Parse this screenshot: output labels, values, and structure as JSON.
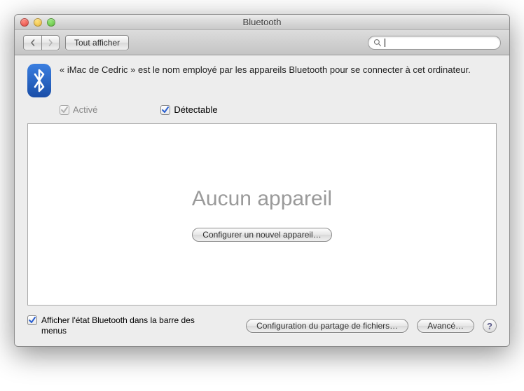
{
  "window": {
    "title": "Bluetooth"
  },
  "toolbar": {
    "show_all_label": "Tout afficher",
    "search_value": ""
  },
  "info": {
    "text": "« iMac de Cedric » est le nom employé par les appareils Bluetooth pour se connecter à cet ordinateur.",
    "activated_label": "Activé",
    "activated_checked": true,
    "activated_enabled": false,
    "discoverable_label": "Détectable",
    "discoverable_checked": true
  },
  "devices": {
    "empty_label": "Aucun appareil",
    "configure_label": "Configurer un nouvel appareil…"
  },
  "bottom": {
    "menubar_label": "Afficher l'état Bluetooth dans la barre des menus",
    "menubar_checked": true,
    "sharing_config_label": "Configuration du partage de fichiers…",
    "advanced_label": "Avancé…"
  }
}
